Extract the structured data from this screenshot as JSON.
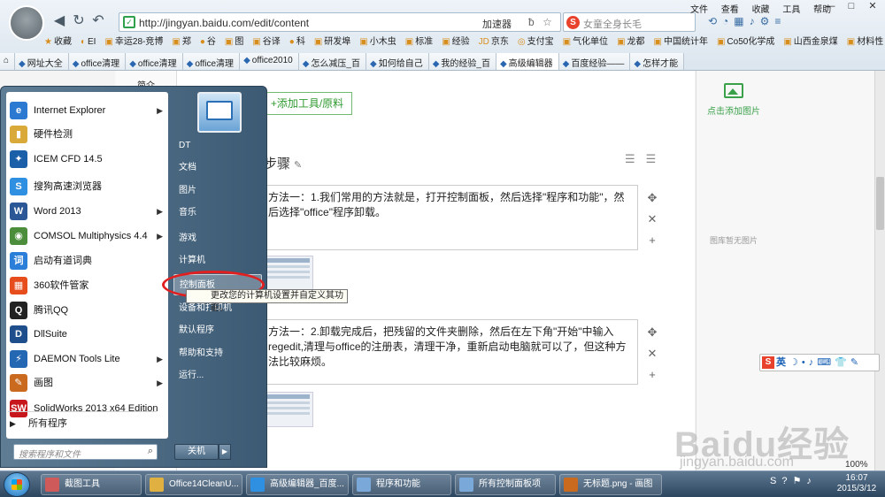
{
  "browser": {
    "url": "http://jingyan.baidu.com/edit/content",
    "accelerator": "加速器",
    "search_placeholder": "女童全身长毛",
    "menus": [
      "文件",
      "查看",
      "收藏",
      "工具",
      "帮助"
    ],
    "window_controls": [
      "—",
      "□",
      "✕"
    ],
    "favorites": [
      {
        "label": "收藏",
        "icon": "★"
      },
      {
        "label": "EI",
        "icon": "◐"
      },
      {
        "label": "幸运28-竞博",
        "icon": "▣"
      },
      {
        "label": "郑",
        "icon": "▣"
      },
      {
        "label": "谷",
        "icon": "●"
      },
      {
        "label": "图",
        "icon": "▣"
      },
      {
        "label": "谷译",
        "icon": "▣"
      },
      {
        "label": "科",
        "icon": "●"
      },
      {
        "label": "研发埠",
        "icon": "▣"
      },
      {
        "label": "小木虫",
        "icon": "▣"
      },
      {
        "label": "标准",
        "icon": "▣"
      },
      {
        "label": "经验",
        "icon": "▣"
      },
      {
        "label": "京东",
        "icon": "JD"
      },
      {
        "label": "支付宝",
        "icon": "◎"
      },
      {
        "label": "气化单位",
        "icon": "▣"
      },
      {
        "label": "龙都",
        "icon": "▣"
      },
      {
        "label": "中国统计年",
        "icon": "▣"
      },
      {
        "label": "Co50化学成",
        "icon": "▣"
      },
      {
        "label": "山西金泉煤",
        "icon": "▣"
      },
      {
        "label": "材料性",
        "icon": "▣"
      }
    ],
    "tabs": [
      {
        "label": "网址大全",
        "active": false
      },
      {
        "label": "office清理",
        "active": false
      },
      {
        "label": "office清理",
        "active": false
      },
      {
        "label": "office清理",
        "active": false
      },
      {
        "label": "office2010",
        "active": false
      },
      {
        "label": "怎么减压_百",
        "active": false
      },
      {
        "label": "如何给自己",
        "active": false
      },
      {
        "label": "我的经验_百",
        "active": false
      },
      {
        "label": "高级编辑器",
        "active": true
      },
      {
        "label": "百度经验——",
        "active": false
      },
      {
        "label": "怎样才能",
        "active": false
      }
    ]
  },
  "editor": {
    "left_label": "简介",
    "add_tool": "+添加工具/原料",
    "steps_title": "步骤",
    "step1": "方法一：1.我们常用的方法就是，打开控制面板，然后选择\"程序和功能\"，然后选择\"office\"程序卸载。",
    "step2": "方法一：2.卸载完成后，把残留的文件夹删除，然后在左下角\"开始\"中输入regedit,清理与office的注册表，清理干净，重新启动电脑就可以了，但这种方法比较麻烦。",
    "step_controls": [
      "✥",
      "✕",
      "+"
    ],
    "add_image": "点击添加图片",
    "no_image": "图库暂无图片",
    "zoom": "100%"
  },
  "watermark": {
    "brand": "Baidu经验",
    "domain": "jingyan.baidu.com"
  },
  "ime": {
    "label": "英"
  },
  "start_menu": {
    "programs": [
      {
        "label": "Internet Explorer",
        "icon": "e",
        "color": "#2b79d0",
        "arrow": true
      },
      {
        "label": "硬件检测",
        "icon": "▮",
        "color": "#d9a93a",
        "arrow": false
      },
      {
        "label": "ICEM CFD 14.5",
        "icon": "✦",
        "color": "#1a5fa8",
        "arrow": false
      },
      {
        "label": "搜狗高速浏览器",
        "icon": "S",
        "color": "#2f8fe0",
        "arrow": false
      },
      {
        "label": "Word 2013",
        "icon": "W",
        "color": "#2b5797",
        "arrow": true
      },
      {
        "label": "COMSOL Multiphysics 4.4",
        "icon": "◉",
        "color": "#4b8d3a",
        "arrow": true
      },
      {
        "label": "启动有道词典",
        "icon": "词",
        "color": "#2c7fd8",
        "arrow": false
      },
      {
        "label": "360软件管家",
        "icon": "▦",
        "color": "#e74c1c",
        "arrow": false
      },
      {
        "label": "腾讯QQ",
        "icon": "Q",
        "color": "#222222",
        "arrow": false
      },
      {
        "label": "DllSuite",
        "icon": "D",
        "color": "#1e4f8c",
        "arrow": false
      },
      {
        "label": "DAEMON Tools Lite",
        "icon": "⚡",
        "color": "#2468b3",
        "arrow": true
      },
      {
        "label": "画图",
        "icon": "✎",
        "color": "#c96a1e",
        "arrow": true
      },
      {
        "label": "SolidWorks 2013 x64 Edition",
        "icon": "SW",
        "color": "#c8161d",
        "arrow": false
      }
    ],
    "all_programs": "所有程序",
    "search_placeholder": "搜索程序和文件",
    "right_items": [
      "DT",
      "文档",
      "图片",
      "音乐",
      "游戏",
      "计算机",
      "控制面板",
      "设备和打印机",
      "默认程序",
      "帮助和支持",
      "运行..."
    ],
    "highlighted": "控制面板",
    "tooltip": "更改您的计算机设置并自定义其功能。",
    "shutdown": "关机"
  },
  "taskbar": {
    "items": [
      {
        "label": "截图工具",
        "color": "#cf5a5a"
      },
      {
        "label": "Office14CleanU...",
        "color": "#e0b040"
      },
      {
        "label": "高级编辑器_百度...",
        "color": "#2f8fe0"
      },
      {
        "label": "程序和功能",
        "color": "#7aa8d8"
      },
      {
        "label": "所有控制面板项",
        "color": "#7aa8d8"
      },
      {
        "label": "无标题.png - 画图",
        "color": "#c96a1e"
      }
    ],
    "time": "16:07",
    "date": "2015/3/12"
  }
}
